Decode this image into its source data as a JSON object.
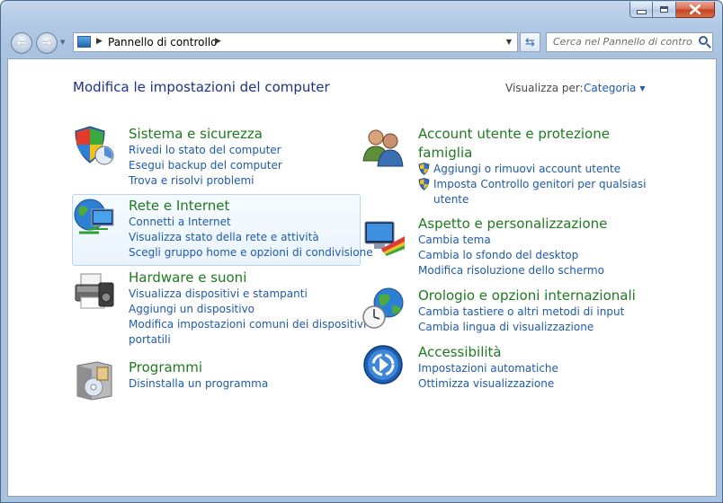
{
  "window": {
    "address": {
      "path_segment": "Pannello di controllo"
    },
    "search": {
      "placeholder": "Cerca nel Pannello di contro..."
    }
  },
  "main": {
    "title": "Modifica le impostazioni del computer",
    "view_by_label": "Visualizza per:",
    "view_by_value": "Categoria"
  },
  "categories": {
    "system": {
      "title": "Sistema e sicurezza",
      "links": [
        "Rivedi lo stato del computer",
        "Esegui backup del computer",
        "Trova e risolvi problemi"
      ]
    },
    "network": {
      "title": "Rete e Internet",
      "links": [
        "Connetti a Internet",
        "Visualizza stato della rete e attività",
        "Scegli gruppo home e opzioni di condivisione"
      ]
    },
    "hardware": {
      "title": "Hardware e suoni",
      "links": [
        "Visualizza dispositivi e stampanti",
        "Aggiungi un dispositivo",
        "Modifica impostazioni comuni dei dispositivi",
        "portatili"
      ]
    },
    "programs": {
      "title": "Programmi",
      "links": [
        "Disinstalla un programma"
      ]
    },
    "accounts": {
      "title_line1": "Account utente e protezione",
      "title_line2": "famiglia",
      "links": [
        "Aggiungi o rimuovi account utente",
        "Imposta Controllo genitori per qualsiasi",
        "utente"
      ]
    },
    "appearance": {
      "title": "Aspetto e personalizzazione",
      "links": [
        "Cambia tema",
        "Cambia lo sfondo del desktop",
        "Modifica risoluzione dello schermo"
      ]
    },
    "clock": {
      "title": "Orologio e opzioni internazionali",
      "links": [
        "Cambia tastiere o altri metodi di input",
        "Cambia lingua di visualizzazione"
      ]
    },
    "ease": {
      "title": "Accessibilità",
      "links": [
        "Impostazioni automatiche",
        "Ottimizza visualizzazione"
      ]
    }
  },
  "colors": {
    "category_title": "#1e7a1e",
    "link": "#1e5ba8",
    "page_title": "#1e3287"
  }
}
